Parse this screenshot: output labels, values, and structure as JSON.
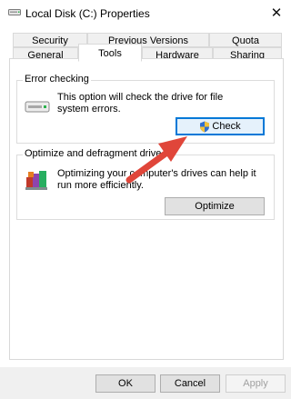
{
  "window": {
    "title": "Local Disk (C:) Properties",
    "close_glyph": "✕"
  },
  "tabs_row1": [
    {
      "label": "Security"
    },
    {
      "label": "Previous Versions"
    },
    {
      "label": "Quota"
    }
  ],
  "tabs_row2": [
    {
      "label": "General"
    },
    {
      "label": "Tools"
    },
    {
      "label": "Hardware"
    },
    {
      "label": "Sharing"
    }
  ],
  "error_checking": {
    "title": "Error checking",
    "description": "This option will check the drive for file system errors.",
    "button_label": "Check",
    "icon": "drive-icon"
  },
  "optimize": {
    "title": "Optimize and defragment drive",
    "description": "Optimizing your computer's drives can help it run more efficiently.",
    "button_label": "Optimize",
    "icon": "defrag-icon"
  },
  "footer": {
    "ok_label": "OK",
    "cancel_label": "Cancel",
    "apply_label": "Apply"
  },
  "colors": {
    "focus": "#0078d7",
    "arrow": "#e0463a",
    "button_face": "#e1e1e1"
  }
}
